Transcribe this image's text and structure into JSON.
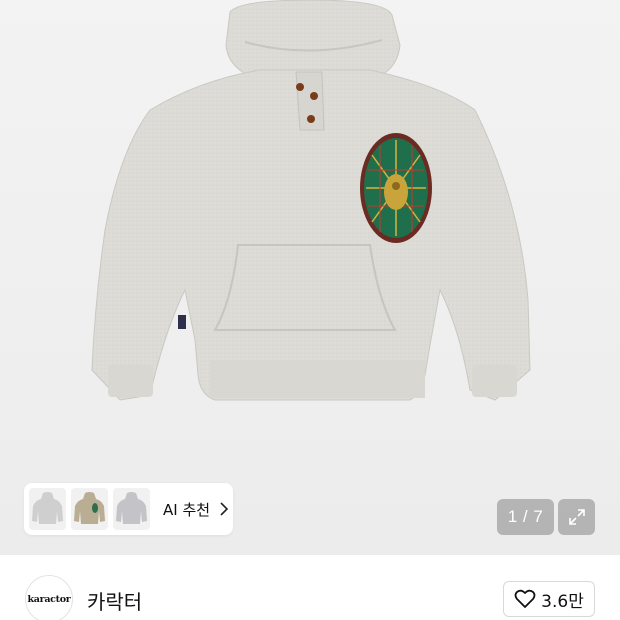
{
  "gallery": {
    "ai_recommend_label": "AI 추천",
    "page_indicator": "1 / 7",
    "current_page": 1,
    "total_pages": 7
  },
  "brand": {
    "logo_text": "karactor",
    "name": "카락터"
  },
  "like": {
    "count": "3.6만"
  },
  "icons": [
    "chevron-right-icon",
    "expand-icon",
    "heart-icon"
  ]
}
